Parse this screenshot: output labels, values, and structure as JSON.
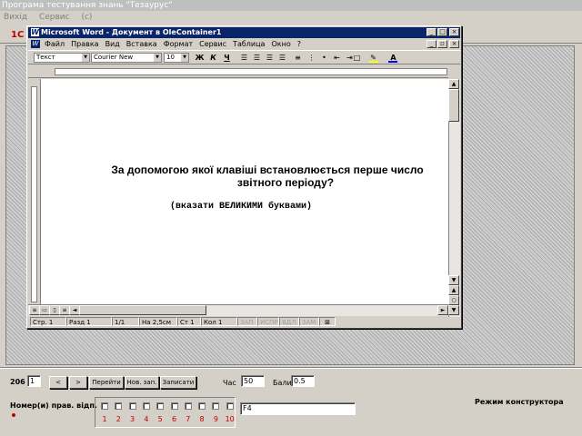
{
  "app": {
    "title": "Програма тестування знань \"Тезаурус\"",
    "menu": [
      "Вихід",
      "Сервис",
      "(с)"
    ],
    "logo": "1С"
  },
  "word": {
    "title": "Microsoft Word - Документ в OleContainer1",
    "menu": [
      "Файл",
      "Правка",
      "Вид",
      "Вставка",
      "Формат",
      "Сервис",
      "Таблица",
      "Окно",
      "?"
    ],
    "style": "Текст",
    "font": "Courier New",
    "size": "10",
    "bold": "Ж",
    "italic": "К",
    "underline": "Ч",
    "font_color_letter": "A",
    "colors": {
      "highlight": "#ffff00",
      "font": "#0000ff"
    },
    "question_line1": "За допомогою якої клавіші встановлюється перше число",
    "question_line2": "звітного періоду?",
    "hint": "(вказати ВЕЛИКИМИ буквами)",
    "status": {
      "page": "Стр. 1",
      "section": "Разд 1",
      "pages": "1/1",
      "at": "На 2,5см",
      "line": "Ст 1",
      "col": "Кол 1",
      "rec": "ЗАП",
      "trk": "ИСПР",
      "ext": "ВДЛ",
      "ovr": "ЗАМ"
    }
  },
  "bottom": {
    "record_number": "206",
    "record_input": "1",
    "prev_label": "<",
    "next_label": ">",
    "goto_label": "Перейти",
    "new_label": "Нов. зап.",
    "save_label": "Записати",
    "time_label": "Час",
    "time_value": "50",
    "score_label": "Бали",
    "score_value": "0.5",
    "answer_label": "Номер(и) прав. відп.",
    "answer_value": "F4",
    "mode_label": "Режим конструктора",
    "checkbox_numbers": [
      "1",
      "2",
      "3",
      "4",
      "5",
      "6",
      "7",
      "8",
      "9",
      "10"
    ]
  }
}
